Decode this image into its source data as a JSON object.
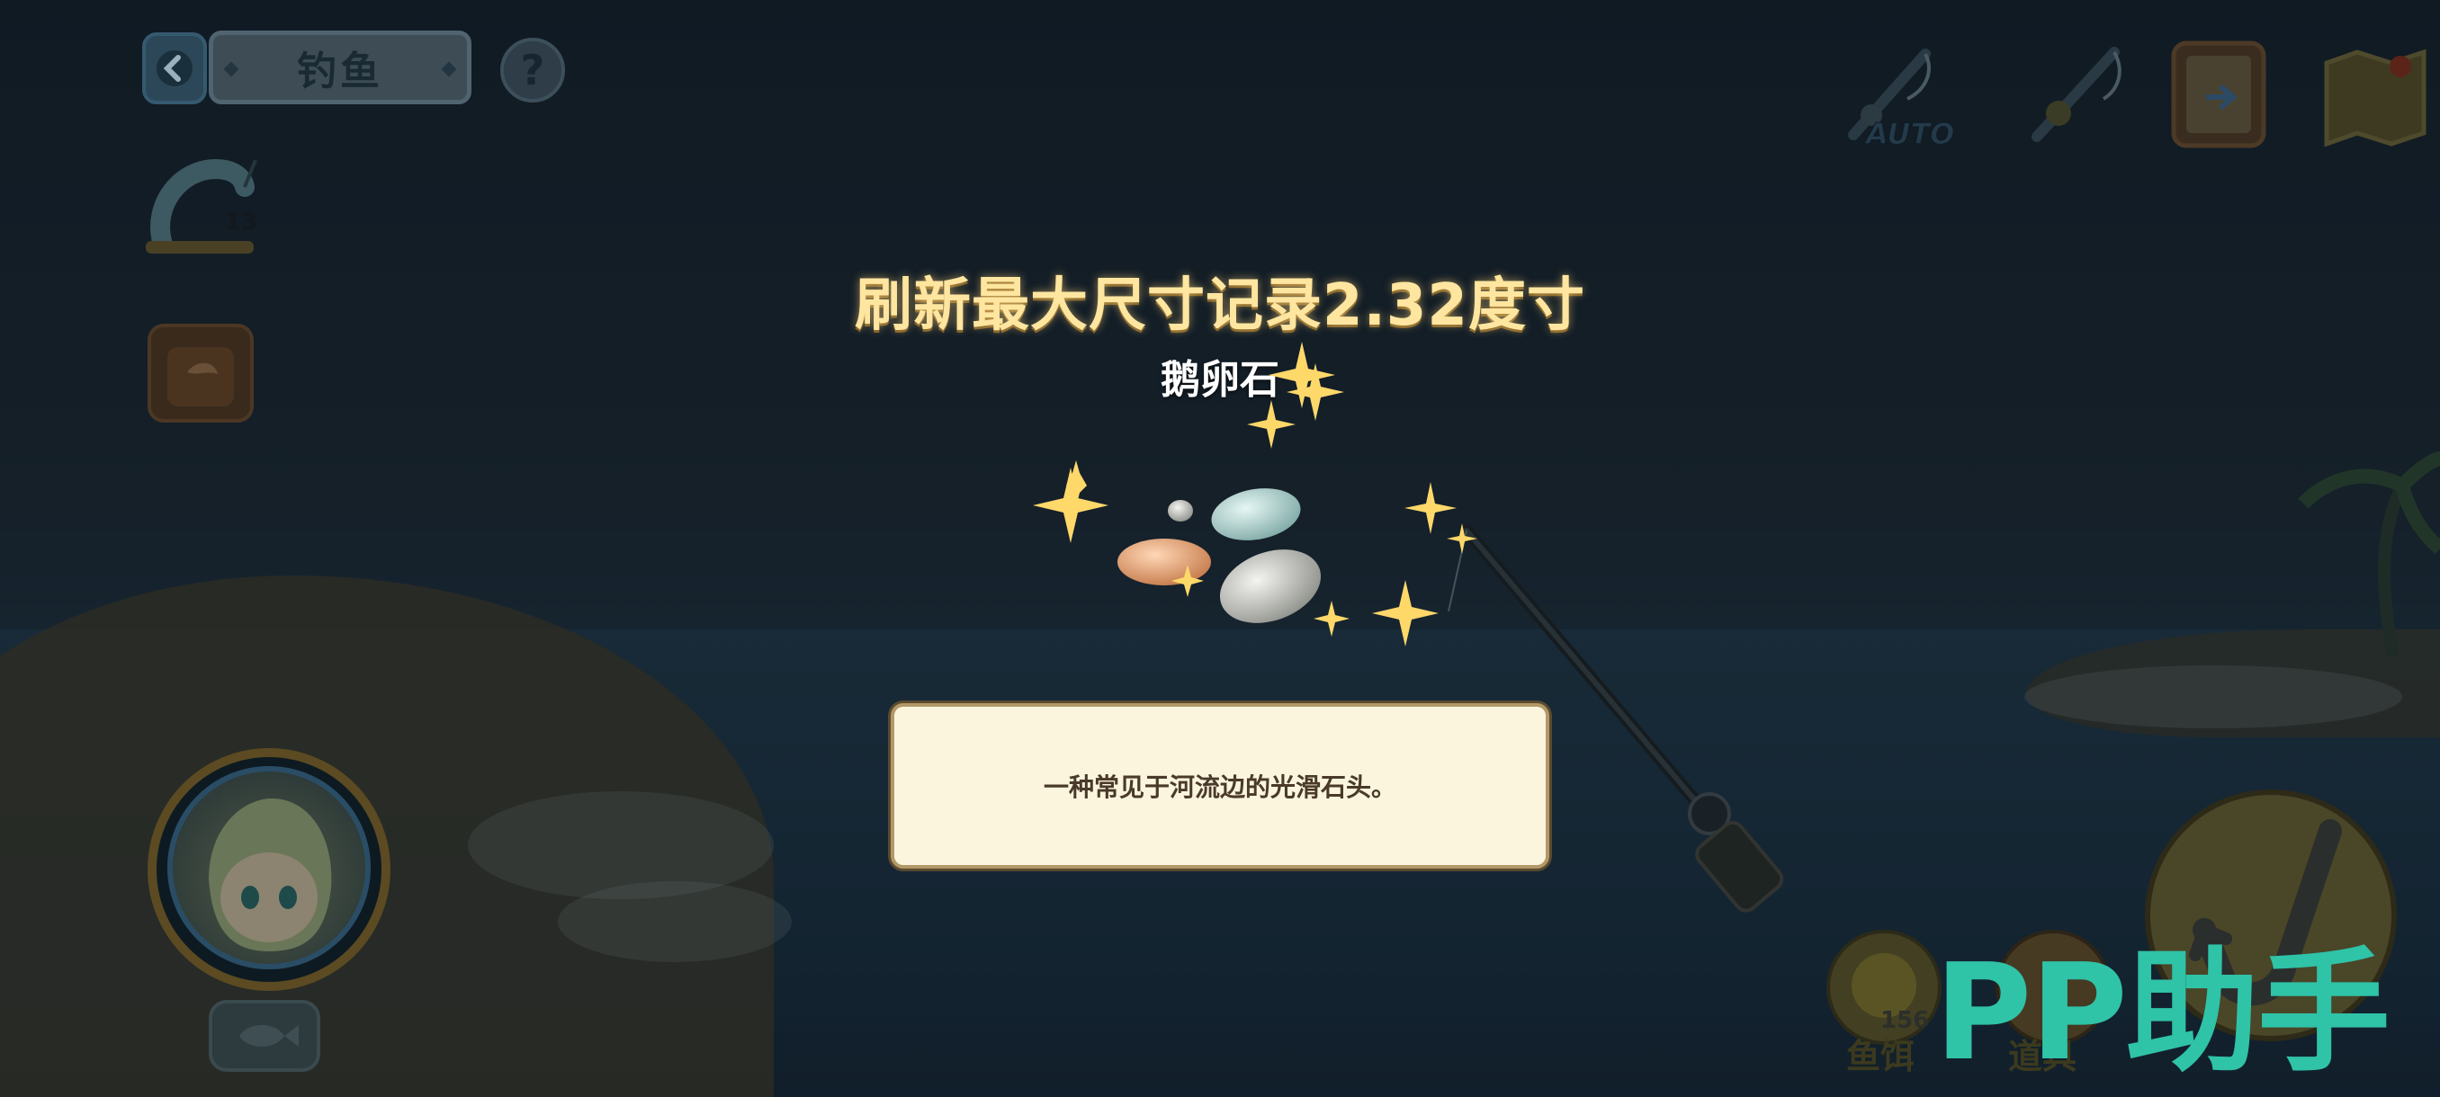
{
  "header": {
    "back_icon": "back-arrow-icon",
    "title": "钓鱼",
    "help_label": "?"
  },
  "left_panel": {
    "bait_count": "13"
  },
  "top_right": {
    "auto_label": "AUTO",
    "icons": [
      "auto-fishing-rod-icon",
      "fishing-rod-icon",
      "quest-clipboard-icon",
      "map-icon"
    ]
  },
  "catch_popup": {
    "record_text": "刷新最大尺寸记录2.32度寸",
    "item_name": "鹅卵石",
    "description": "一种常见于河流边的光滑石头。"
  },
  "bottom_right": {
    "bait_count": "156",
    "bait_label": "鱼饵",
    "tool_label": "道具"
  },
  "watermark": "PP助手",
  "colors": {
    "record_text": "#ffe6a0",
    "desc_bg": "#fbf5de",
    "watermark": "#2fc3a8"
  }
}
